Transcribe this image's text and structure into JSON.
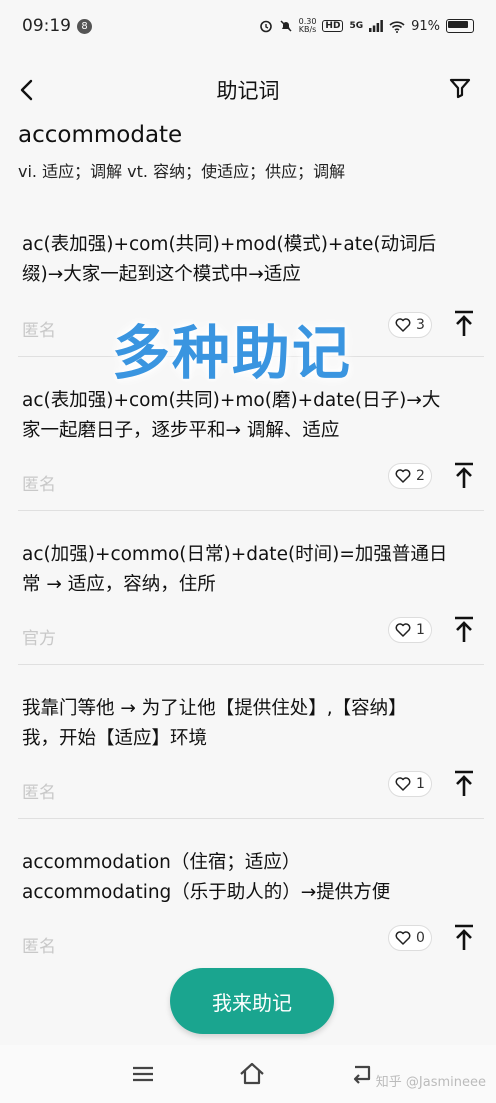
{
  "status_bar": {
    "time": "09:19",
    "notif_count": "8",
    "speed_value": "0.30",
    "speed_unit": "KB/s",
    "hd": "HD",
    "network": "5G",
    "battery": "91%"
  },
  "header": {
    "title": "助记词"
  },
  "word": {
    "text": "accommodate",
    "definition": "vi. 适应；调解 vt. 容纳；使适应；供应；调解"
  },
  "overlay_text": "多种助记",
  "mnemonics": [
    {
      "lines": [
        "ac(表加强)+com(共同)+mod(模式)+ate(动词后",
        "缀)→大家一起到这个模式中→适应"
      ],
      "author": "匿名",
      "likes": "3"
    },
    {
      "lines": [
        "ac(表加强)+com(共同)+mo(磨)+date(日子)→大",
        "家一起磨日子，逐步平和→ 调解、适应"
      ],
      "author": "匿名",
      "likes": "2"
    },
    {
      "lines": [
        "ac(加强)+commo(日常)+date(时间)=加强普通日",
        "常 → 适应，容纳，住所"
      ],
      "author": "官方",
      "likes": "1"
    },
    {
      "lines": [
        "我靠门等他 → 为了让他【提供住处】,【容纳】",
        "我，开始【适应】环境"
      ],
      "author": "匿名",
      "likes": "1"
    },
    {
      "lines": [
        "accommodation（住宿；适应）",
        "accommodating（乐于助人的）→提供方便"
      ],
      "author": "匿名",
      "likes": "0"
    }
  ],
  "cta": {
    "label": "我来助记"
  },
  "credit": "知乎 @Jasmineee",
  "colors": {
    "accent": "#1aa58f",
    "overlay": "#3a95e0",
    "muted_text": "#c8c8c8"
  }
}
